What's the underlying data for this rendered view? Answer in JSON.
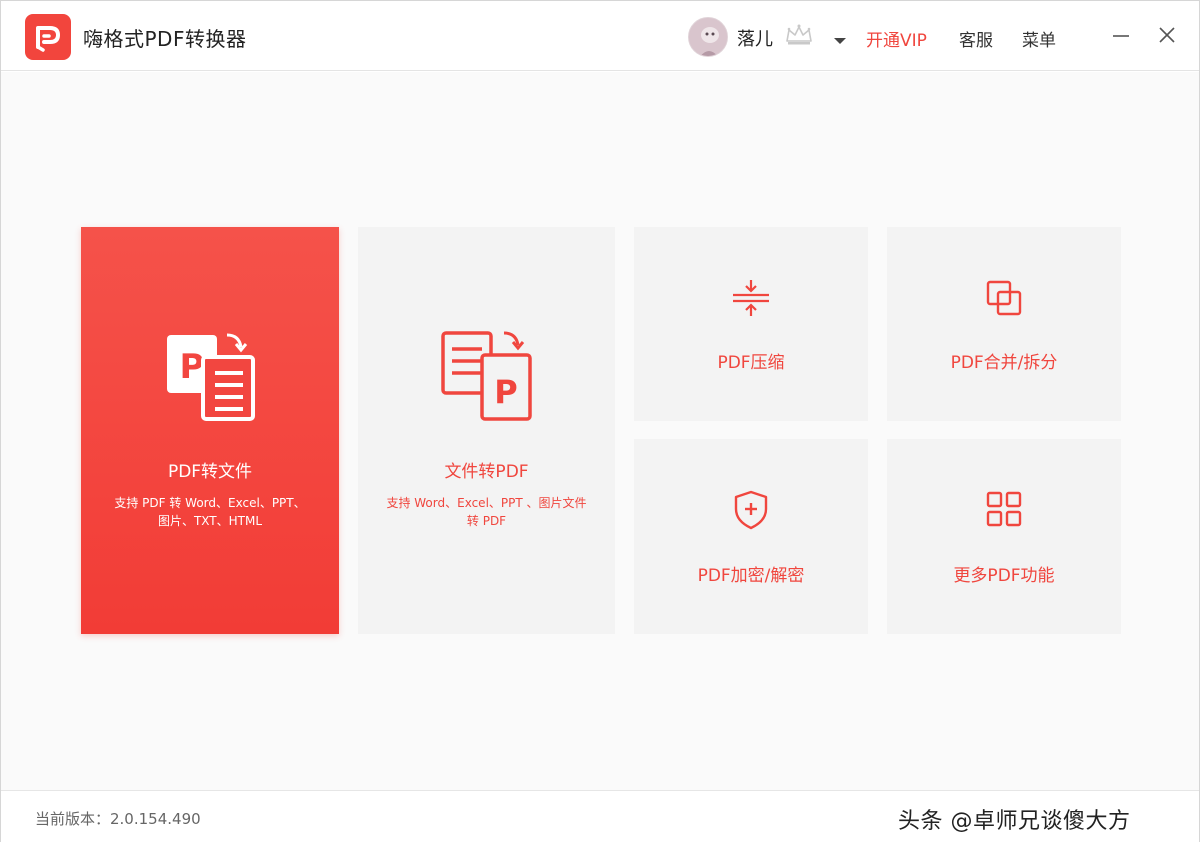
{
  "app": {
    "title": "嗨格式PDF转换器"
  },
  "user": {
    "name": "落儿",
    "vip_label": "开通VIP",
    "service_label": "客服",
    "menu_label": "菜单"
  },
  "cards": {
    "pdf_to_file": {
      "title": "PDF转文件",
      "desc": "支持 PDF 转 Word、Excel、PPT、图片、TXT、HTML"
    },
    "file_to_pdf": {
      "title": "文件转PDF",
      "desc": "支持 Word、Excel、PPT 、图片文件转 PDF"
    },
    "compress": {
      "title": "PDF压缩"
    },
    "merge": {
      "title": "PDF合并/拆分"
    },
    "encrypt": {
      "title": "PDF加密/解密"
    },
    "more": {
      "title": "更多PDF功能"
    }
  },
  "footer": {
    "version_text": "当前版本：2.0.154.490",
    "watermark": "头条 @卓师兄谈傻大方"
  },
  "colors": {
    "accent": "#f0463e",
    "card_bg": "#f3f3f3"
  },
  "icons": {
    "logo": "pdf-logo-icon",
    "crown": "crown-icon",
    "dropdown": "caret-down-icon",
    "minimize": "minimize-icon",
    "close": "close-icon",
    "pdf_to_file": "pdf-to-document-icon",
    "file_to_pdf": "document-to-pdf-icon",
    "compress": "compress-icon",
    "merge": "merge-squares-icon",
    "encrypt": "shield-plus-icon",
    "more": "grid-icon"
  }
}
